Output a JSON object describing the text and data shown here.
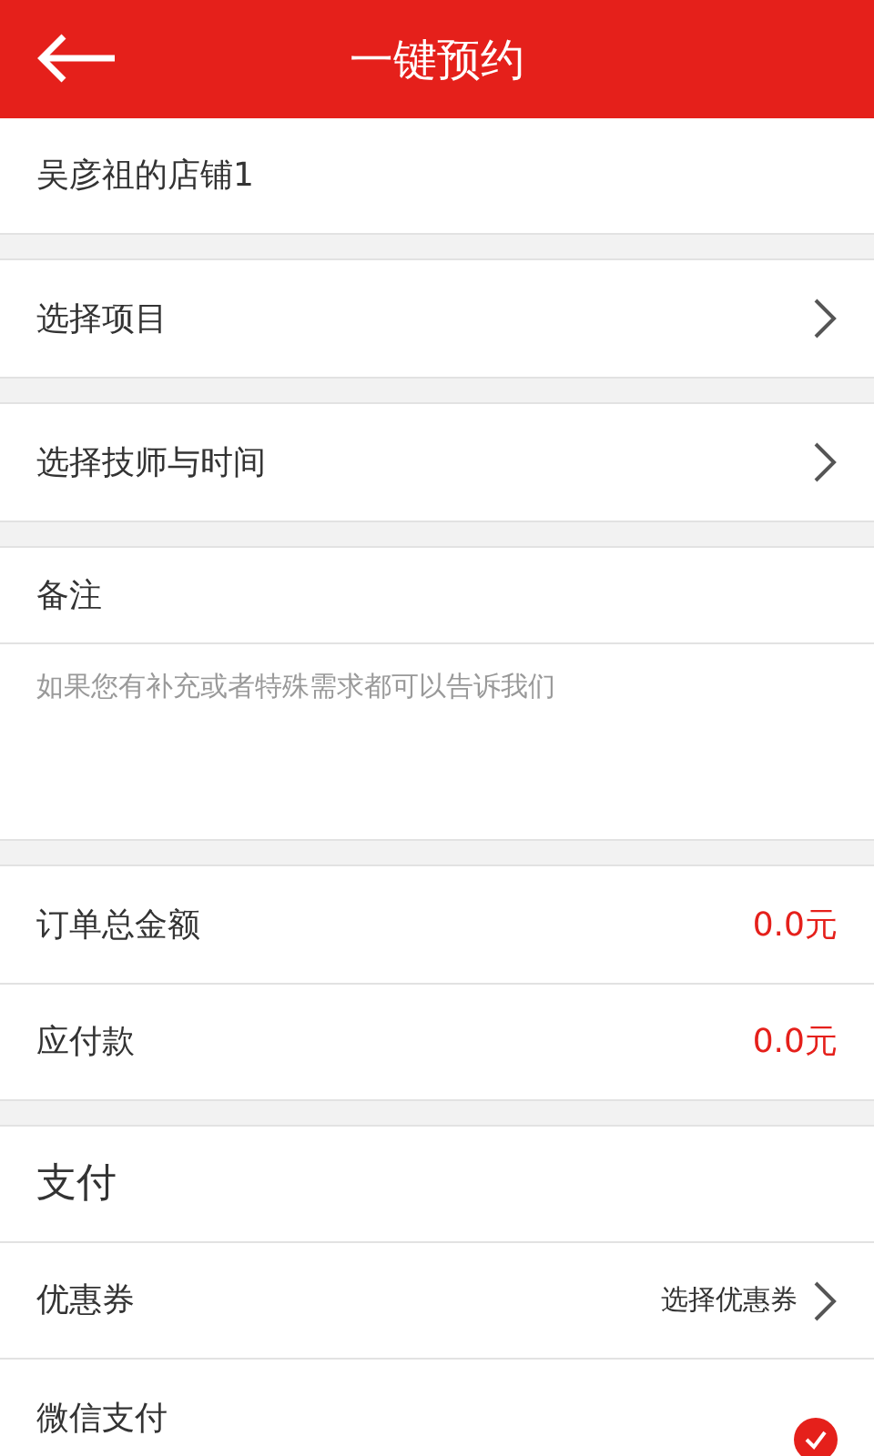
{
  "header": {
    "title": "一键预约"
  },
  "shop": {
    "name": "吴彦祖的店铺1"
  },
  "choices": [
    {
      "label": "选择项目"
    },
    {
      "label": "选择技师与时间"
    }
  ],
  "note": {
    "label": "备注",
    "placeholder": "如果您有补充或者特殊需求都可以告诉我们"
  },
  "amounts": [
    {
      "label": "订单总金额",
      "value": "0.0元"
    },
    {
      "label": "应付款",
      "value": "0.0元"
    }
  ],
  "payment": {
    "title": "支付",
    "coupon": {
      "label": "优惠券",
      "value": "选择优惠券"
    },
    "methods": [
      {
        "label": "微信支付",
        "selected": true
      }
    ]
  }
}
